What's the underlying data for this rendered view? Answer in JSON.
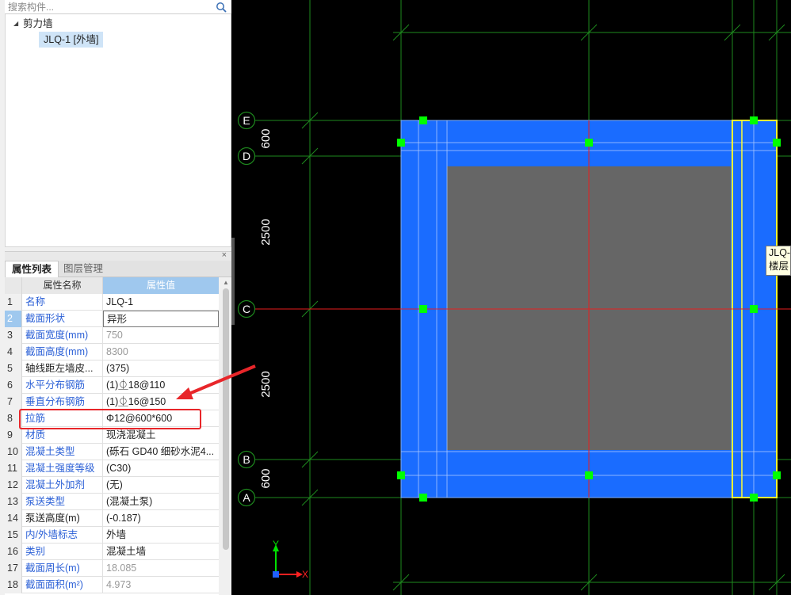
{
  "search": {
    "placeholder": "搜索构件..."
  },
  "tree": {
    "root": "剪力墙",
    "child": "JLQ-1 [外墙]"
  },
  "panel": {
    "close": "×",
    "tabs": [
      "属性列表",
      "图层管理"
    ]
  },
  "table": {
    "header_name": "属性名称",
    "header_value": "属性值",
    "rows": [
      {
        "num": "1",
        "name": "名称",
        "value": "JLQ-1",
        "name_color": "blue",
        "value_style": "normal"
      },
      {
        "num": "2",
        "name": "截面形状",
        "value": "异形",
        "name_color": "blue",
        "value_style": "normal",
        "selected": true
      },
      {
        "num": "3",
        "name": "截面宽度(mm)",
        "value": "750",
        "name_color": "blue",
        "value_style": "gray"
      },
      {
        "num": "4",
        "name": "截面高度(mm)",
        "value": "8300",
        "name_color": "blue",
        "value_style": "gray"
      },
      {
        "num": "5",
        "name": "轴线距左墙皮...",
        "value": "(375)",
        "name_color": "black",
        "value_style": "normal"
      },
      {
        "num": "6",
        "name": "水平分布钢筋",
        "value": "(1)⏂18@110",
        "name_color": "blue",
        "value_style": "normal"
      },
      {
        "num": "7",
        "name": "垂直分布钢筋",
        "value": "(1)⏂16@150",
        "name_color": "blue",
        "value_style": "normal"
      },
      {
        "num": "8",
        "name": "拉筋",
        "value": "Φ12@600*600",
        "name_color": "blue",
        "value_style": "normal"
      },
      {
        "num": "9",
        "name": "材质",
        "value": "现浇混凝土",
        "name_color": "blue",
        "value_style": "normal"
      },
      {
        "num": "10",
        "name": "混凝土类型",
        "value": "(砾石 GD40 细砂水泥4...",
        "name_color": "blue",
        "value_style": "normal"
      },
      {
        "num": "11",
        "name": "混凝土强度等级",
        "value": "(C30)",
        "name_color": "blue",
        "value_style": "normal"
      },
      {
        "num": "12",
        "name": "混凝土外加剂",
        "value": "(无)",
        "name_color": "blue",
        "value_style": "normal"
      },
      {
        "num": "13",
        "name": "泵送类型",
        "value": "(混凝土泵)",
        "name_color": "blue",
        "value_style": "normal"
      },
      {
        "num": "14",
        "name": "泵送高度(m)",
        "value": "(-0.187)",
        "name_color": "black",
        "value_style": "normal"
      },
      {
        "num": "15",
        "name": "内/外墙标志",
        "value": "外墙",
        "name_color": "blue",
        "value_style": "normal"
      },
      {
        "num": "16",
        "name": "类别",
        "value": "混凝土墙",
        "name_color": "blue",
        "value_style": "normal"
      },
      {
        "num": "17",
        "name": "截面周长(m)",
        "value": "18.085",
        "name_color": "blue",
        "value_style": "gray"
      },
      {
        "num": "18",
        "name": "截面面积(m²)",
        "value": "4.973",
        "name_color": "blue",
        "value_style": "gray"
      }
    ]
  },
  "canvas": {
    "axes": {
      "E": "E",
      "D": "D",
      "C": "C",
      "B": "B",
      "A": "A"
    },
    "dimensions": [
      "600",
      "2500",
      "2500",
      "600"
    ],
    "wall_label_lines": [
      "JLQ-",
      "楼层"
    ],
    "ucs": {
      "x": "X",
      "y": "Y"
    }
  },
  "colors": {
    "wall_fill": "#1a6cff",
    "void_fill": "#666666",
    "grip": "#00ff00",
    "axis_line": "#e81e1e",
    "grid_line": "#1e8a1e",
    "selected_outline": "#ffff33",
    "arrow": "#e8262a"
  }
}
